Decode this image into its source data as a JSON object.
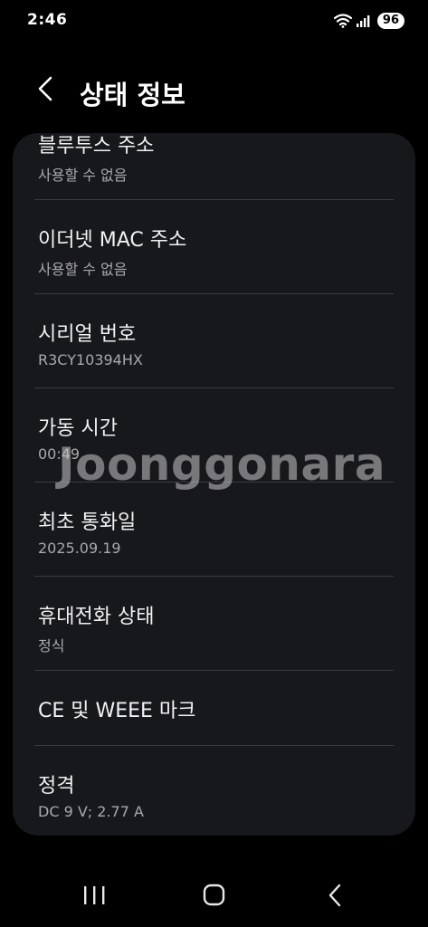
{
  "status_bar": {
    "time": "2:46",
    "battery": "96",
    "wifi_icon": "wifi-icon",
    "signal_icon": "cellular-signal-icon"
  },
  "header": {
    "title": "상태 정보",
    "back_icon": "chevron-left-icon"
  },
  "items": [
    {
      "title": "블루투스 주소",
      "value": "사용할 수 없음"
    },
    {
      "title": "이더넷 MAC 주소",
      "value": "사용할 수 없음"
    },
    {
      "title": "시리얼 번호",
      "value": "R3CY10394HX"
    },
    {
      "title": "가동 시간",
      "value": "00:49"
    },
    {
      "title": "최초 통화일",
      "value": "2025.09.19"
    },
    {
      "title": "휴대전화 상태",
      "value": "정식"
    },
    {
      "title": "CE 및 WEEE 마크"
    },
    {
      "title": "정격",
      "value": "DC 9 V; 2.77 A"
    }
  ],
  "watermark": "Joonggonara",
  "nav": {
    "recents_icon": "recent-apps-icon",
    "home_icon": "home-icon",
    "back_icon": "back-icon"
  },
  "colors": {
    "background": "#000000",
    "card": "#17181b",
    "divider": "#3a3b3f",
    "secondary_text": "#a9a9ad"
  }
}
